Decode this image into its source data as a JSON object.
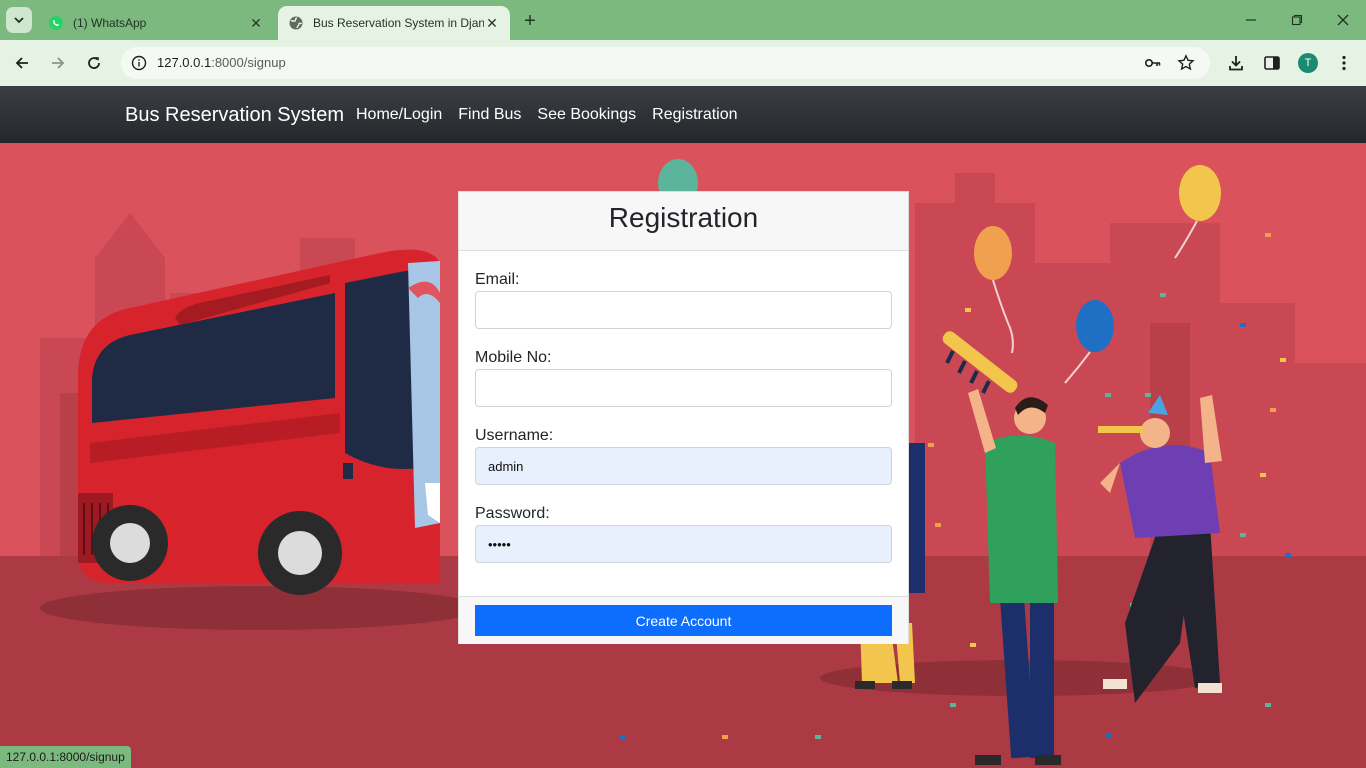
{
  "browser": {
    "tabs": [
      {
        "title": "(1) WhatsApp",
        "icon": "whatsapp-icon",
        "active": false
      },
      {
        "title": "Bus Reservation System in Djan",
        "icon": "globe-icon",
        "active": true
      }
    ],
    "url_host": "127.0.0.1",
    "url_path": ":8000/signup",
    "profile_initial": "T",
    "status_url": "127.0.0.1:8000/signup"
  },
  "site": {
    "brand": "Bus Reservation System",
    "nav": [
      "Home/Login",
      "Find Bus",
      "See Bookings",
      "Registration"
    ]
  },
  "form": {
    "title": "Registration",
    "email_label": "Email:",
    "email_value": "",
    "mobile_label": "Mobile No:",
    "mobile_value": "",
    "username_label": "Username:",
    "username_value": "admin",
    "password_label": "Password:",
    "password_value": "•••••",
    "submit_label": "Create Account"
  },
  "colors": {
    "accent": "#0d6efd",
    "navbar": "#2b2f33",
    "hero_background": "#d9525c",
    "tabstrip": "#7cb97e"
  }
}
